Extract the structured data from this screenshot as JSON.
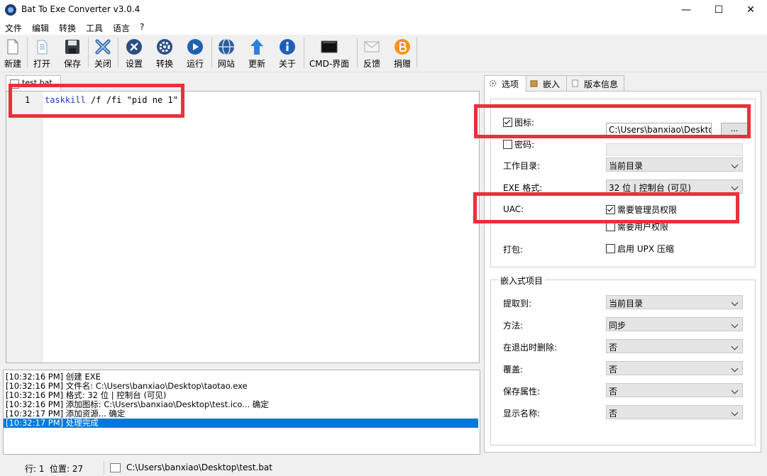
{
  "window": {
    "title": "Bat To Exe Converter v3.0.4",
    "minimize": "—",
    "maximize": "☐",
    "close": "✕"
  },
  "menu": [
    "文件",
    "编辑",
    "转换",
    "工具",
    "语言",
    "?"
  ],
  "toolbar": [
    {
      "label": "新建",
      "icon": "new-file-icon"
    },
    {
      "label": "打开",
      "icon": "open-folder-icon"
    },
    {
      "label": "保存",
      "icon": "save-floppy-icon"
    },
    {
      "label": "关闭",
      "icon": "close-x-icon"
    },
    {
      "label": "设置",
      "icon": "settings-wrench-icon"
    },
    {
      "label": "转换",
      "icon": "convert-gear-icon"
    },
    {
      "label": "运行",
      "icon": "run-play-icon"
    },
    {
      "label": "网站",
      "icon": "website-globe-icon"
    },
    {
      "label": "更新",
      "icon": "update-arrow-icon"
    },
    {
      "label": "关于",
      "icon": "about-info-icon"
    },
    {
      "label": "CMD-界面",
      "icon": "cmd-console-icon"
    },
    {
      "label": "反馈",
      "icon": "feedback-mail-icon"
    },
    {
      "label": "捐赠",
      "icon": "donate-bitcoin-icon"
    }
  ],
  "editor": {
    "tab": "test.bat",
    "line_number": "1",
    "code_keyword": "taskkill",
    "code_rest": " /f /fi \"pid ne 1\""
  },
  "log": [
    "[10:32:16 PM] 创建 EXE",
    "[10:32:16 PM] 文件名: C:\\Users\\banxiao\\Desktop\\taotao.exe",
    "[10:32:16 PM] 格式: 32 位 | 控制台 (可见)",
    "[10:32:16 PM] 添加图标: C:\\Users\\banxiao\\Desktop\\test.ico... 确定",
    "[10:32:17 PM] 添加资源... 确定",
    "[10:32:17 PM] 处理完成"
  ],
  "right_tabs": [
    "选项",
    "嵌入",
    "版本信息"
  ],
  "options": {
    "icon_label": "图标:",
    "icon_checked": true,
    "icon_path": "C:\\Users\\banxiao\\Desktop\\test.ico",
    "browse": "...",
    "password_label": "密码:",
    "password_checked": false,
    "password_value": "",
    "workdir_label": "工作目录:",
    "workdir_value": "当前目录",
    "exe_format_label": "EXE 格式:",
    "exe_format_value": "32 位 | 控制台 (可见)",
    "uac_label": "UAC:",
    "uac_admin": "需要管理员权限",
    "uac_admin_checked": true,
    "uac_user": "需要用户权限",
    "uac_user_checked": false,
    "pack_label": "打包:",
    "upx": "启用 UPX 压缩",
    "upx_checked": false
  },
  "embedded": {
    "group_title": "嵌入式项目",
    "rows": [
      {
        "label": "提取到:",
        "value": "当前目录"
      },
      {
        "label": "方法:",
        "value": "同步"
      },
      {
        "label": "在退出时删除:",
        "value": "否"
      },
      {
        "label": "覆盖:",
        "value": "否"
      },
      {
        "label": "保存属性:",
        "value": "否"
      },
      {
        "label": "显示名称:",
        "value": "否"
      }
    ]
  },
  "status": {
    "line": "行: 1",
    "position": "位置: 27",
    "file_path": "C:\\Users\\banxiao\\Desktop\\test.bat"
  },
  "colors": {
    "highlight": "#e8313a",
    "selection": "#0078d7",
    "keyword": "#1e3fbf"
  }
}
